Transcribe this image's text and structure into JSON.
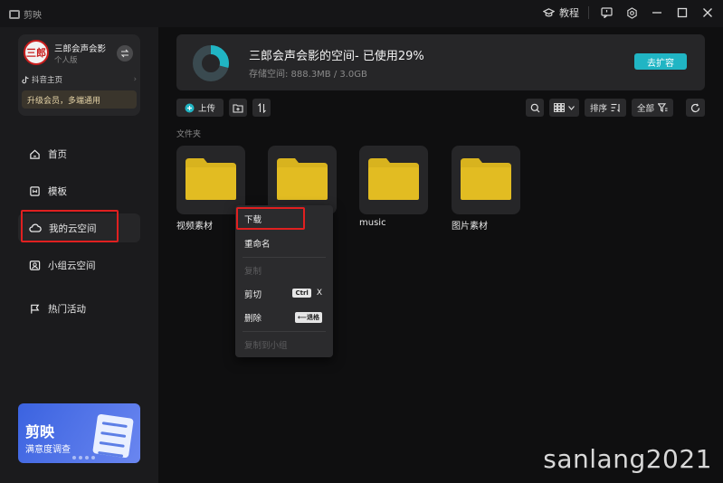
{
  "app": {
    "name": "剪映"
  },
  "titlebar": {
    "tutorial_label": "教程"
  },
  "user": {
    "avatar_text": "三郎",
    "name": "三郎会声会影",
    "plan": "个人版",
    "douyin_link": "抖音主页",
    "upgrade_label": "升级会员，多端通用"
  },
  "sidebar": {
    "items": [
      {
        "label": "首页",
        "icon": "home-icon"
      },
      {
        "label": "模板",
        "icon": "template-icon"
      },
      {
        "label": "我的云空间",
        "icon": "cloud-icon",
        "active": true
      },
      {
        "label": "小组云空间",
        "icon": "group-icon"
      },
      {
        "label": "热门活动",
        "icon": "flag-icon"
      }
    ],
    "banner": {
      "title": "剪映",
      "subtitle": "满意度调查"
    }
  },
  "storage": {
    "title": "三郎会声会影的空间- 已使用29%",
    "usage_text": "存储空间: 888.3MB / 3.0GB",
    "used_fraction": 0.29,
    "expand_label": "去扩容",
    "colors": {
      "used": "#20b5c4",
      "free": "#3a4a50"
    }
  },
  "toolbar": {
    "upload_label": "上传",
    "sort_label": "排序",
    "filter_label": "全部"
  },
  "files": {
    "section_label": "文件夹",
    "folders": [
      {
        "name": "视频素材"
      },
      {
        "name": ""
      },
      {
        "name": "music"
      },
      {
        "name": "图片素材"
      }
    ]
  },
  "context_menu": {
    "items": [
      {
        "label": "下载",
        "disabled": false
      },
      {
        "label": "重命名",
        "disabled": false
      },
      {
        "label": "复制",
        "disabled": true
      },
      {
        "label": "剪切",
        "disabled": false,
        "key": "Ctrl",
        "key2": "X"
      },
      {
        "label": "删除",
        "disabled": false,
        "key": "⟵退格"
      },
      {
        "label": "复制到小组",
        "disabled": true
      }
    ]
  },
  "watermark": "sanlang2021"
}
